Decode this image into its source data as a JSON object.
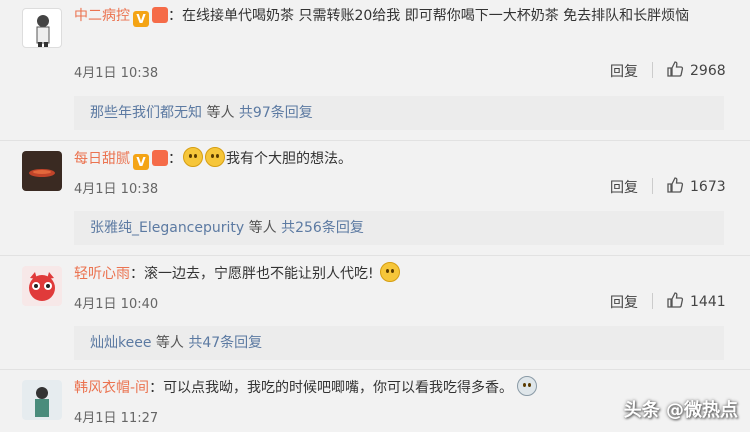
{
  "comments": [
    {
      "user": "中二病控",
      "separator": "：",
      "text": "在线接单代喝奶茶 只需转账20给我 即可帮你喝下一大杯奶茶 免去排队和长胖烦恼",
      "date": "4月1日 10:38",
      "reply_label": "回复",
      "likes": "2968",
      "thread_name": "那些年我们都无知",
      "thread_mid": " 等人 ",
      "thread_count": "共97条回复"
    },
    {
      "user": "每日甜腻",
      "separator": "：",
      "text": "我有个大胆的想法。",
      "date": "4月1日 10:38",
      "reply_label": "回复",
      "likes": "1673",
      "thread_name": "张雅纯_Elegancepurity",
      "thread_mid": " 等人 ",
      "thread_count": "共256条回复"
    },
    {
      "user": "轻听心雨",
      "separator": "：",
      "text": "滚一边去，宁愿胖也不能让别人代吃!",
      "date": "4月1日 10:40",
      "reply_label": "回复",
      "likes": "1441",
      "thread_name": "灿灿keee",
      "thread_mid": " 等人 ",
      "thread_count": "共47条回复"
    },
    {
      "user": "韩风衣帽-间",
      "separator": "：",
      "text": "可以点我呦，我吃的时候吧唧嘴，你可以看我吃得多香。",
      "date": "4月1日 11:27"
    }
  ],
  "watermark": "头条 @微热点",
  "colors": {
    "username": "#eb7350",
    "link": "#5c7aa2",
    "background": "#f2f2f2"
  }
}
